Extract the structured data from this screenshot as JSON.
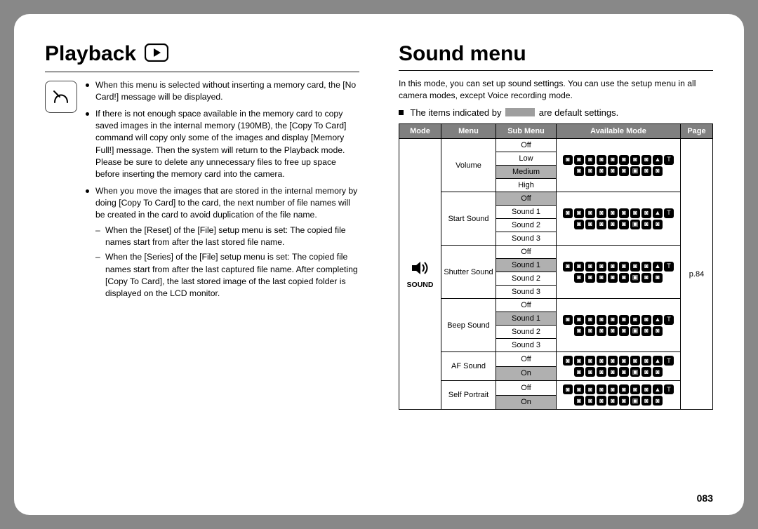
{
  "page_number": "083",
  "left": {
    "title": "Playback",
    "notes": [
      "When this menu is selected without inserting a memory card, the [No Card!] message will be displayed.",
      "If there is not enough space available in the memory card to copy saved images in the internal memory (190MB), the [Copy To Card] command will copy only some of the images and display [Memory Full!] message. Then the system will return to the Playback mode. Please be sure to delete any unnecessary files to free up space before inserting the memory card into the camera.",
      "When you move the images that are stored in the internal memory by doing [Copy To Card] to the card, the next number of file names will be created in the card to avoid duplication of the file name."
    ],
    "subnotes": [
      "When the [Reset] of the [File] setup menu is set: The copied file names start from after the last stored file name.",
      "When the [Series] of the [File] setup menu is set: The copied file names start from after the last captured file name. After completing [Copy To Card], the last stored image of the last copied folder is displayed on the LCD monitor."
    ]
  },
  "right": {
    "title": "Sound menu",
    "intro": "In this mode, you can set up sound settings. You can use the setup menu in all camera modes, except Voice recording mode.",
    "legend_pre": "The items indicated by",
    "legend_post": "are default settings.",
    "table": {
      "headers": [
        "Mode",
        "Menu",
        "Sub Menu",
        "Available Mode",
        "Page"
      ],
      "mode_label": "SOUND",
      "page_ref": "p.84",
      "rows": [
        {
          "menu": "Volume",
          "sub": [
            "Off",
            "Low",
            "Medium",
            "High"
          ],
          "default": "Medium"
        },
        {
          "menu": "Start Sound",
          "sub": [
            "Off",
            "Sound 1",
            "Sound 2",
            "Sound 3"
          ],
          "default": "Off"
        },
        {
          "menu": "Shutter Sound",
          "sub": [
            "Off",
            "Sound 1",
            "Sound 2",
            "Sound 3"
          ],
          "default": "Sound 1"
        },
        {
          "menu": "Beep Sound",
          "sub": [
            "Off",
            "Sound 1",
            "Sound 2",
            "Sound 3"
          ],
          "default": "Sound 1"
        },
        {
          "menu": "AF Sound",
          "sub": [
            "Off",
            "On"
          ],
          "default": "On"
        },
        {
          "menu": "Self Portrait",
          "sub": [
            "Off",
            "On"
          ],
          "default": "On"
        }
      ],
      "available_mode_icons": [
        "◙",
        "◙",
        "◙",
        "◙",
        "◙",
        "◙",
        "◙",
        "◙",
        "▲",
        "T",
        "◙",
        "◙",
        "◙",
        "◙",
        "◙",
        "▣",
        "◙",
        "◙"
      ]
    }
  }
}
